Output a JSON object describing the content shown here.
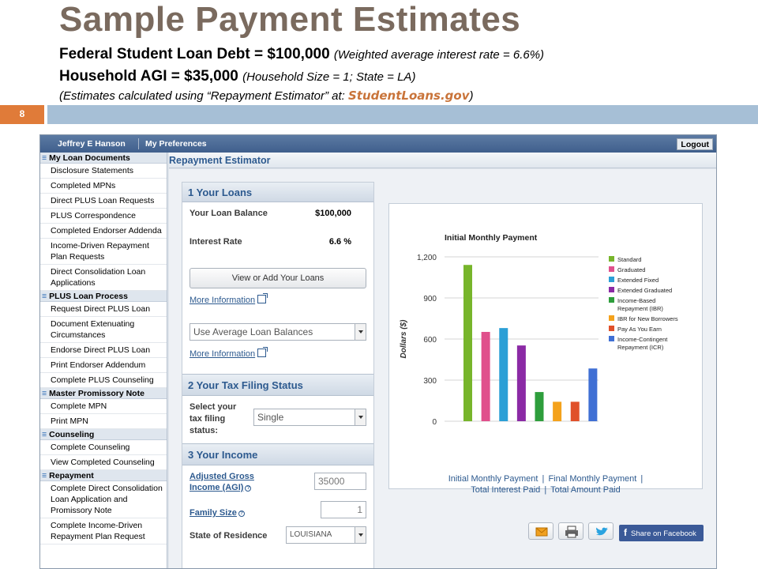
{
  "slide": {
    "title": "Sample Payment Estimates",
    "line1_main": "Federal Student Loan Debt = $100,000",
    "line1_note": "(Weighted average interest rate = 6.6%)",
    "line2_main": "Household AGI = $35,000",
    "line2_note": "(Household Size = 1; State = LA)",
    "line3_prefix": "(Estimates calculated using “Repayment Estimator” at: ",
    "line3_brand": "StudentLoans.gov",
    "line3_suffix": ")",
    "number": "8"
  },
  "topbar": {
    "user": "Jeffrey E Hanson",
    "preferences": "My Preferences",
    "logout": "Logout"
  },
  "sidebar": {
    "sections": [
      {
        "title": "My Loan Documents",
        "items": [
          "Disclosure Statements",
          "Completed MPNs",
          "Direct PLUS Loan Requests",
          "PLUS Correspondence",
          "Completed Endorser Addenda",
          "Income-Driven Repayment Plan Requests",
          "Direct Consolidation Loan Applications"
        ]
      },
      {
        "title": "PLUS Loan Process",
        "items": [
          "Request Direct PLUS Loan",
          "Document Extenuating Circumstances",
          "Endorse Direct PLUS Loan",
          "Print Endorser Addendum",
          "Complete PLUS Counseling"
        ]
      },
      {
        "title": "Master Promissory Note",
        "items": [
          "Complete MPN",
          "Print MPN"
        ]
      },
      {
        "title": "Counseling",
        "items": [
          "Complete Counseling",
          "View Completed Counseling"
        ]
      },
      {
        "title": "Repayment",
        "items": [
          "Complete Direct Consolidation Loan Application and Promissory Note",
          "Complete Income-Driven Repayment Plan Request"
        ]
      }
    ]
  },
  "main": {
    "title": "Repayment Estimator",
    "loans": {
      "heading": "1 Your Loans",
      "balance_label": "Your Loan Balance",
      "balance_value": "$100,000",
      "rate_label": "Interest Rate",
      "rate_value": "6.6 %",
      "view_button": "View or Add Your Loans",
      "more_info_1": "More Information",
      "average_select": "Use Average Loan Balances",
      "more_info_2": "More Information"
    },
    "tax": {
      "heading": "2 Your Tax Filing Status",
      "label": "Select your tax filing status:",
      "value": "Single"
    },
    "income": {
      "heading": "3 Your Income",
      "agi_label": "Adjusted Gross Income (AGI)",
      "agi_value": "35000",
      "family_label": "Family Size",
      "family_value": "1",
      "state_label": "State of Residence",
      "state_value": "LOUISIANA"
    },
    "chart_links": {
      "initial": "Initial Monthly Payment",
      "final": "Final Monthly Payment",
      "total_interest": "Total Interest Paid",
      "total_amount": "Total Amount Paid"
    },
    "share": {
      "facebook": "Share on Facebook"
    }
  },
  "chart_data": {
    "type": "bar",
    "title": "Initial Monthly Payment",
    "ylabel": "Dollars ($)",
    "xlabel": "",
    "ylim": [
      0,
      1200
    ],
    "yticks": [
      0,
      300,
      600,
      900,
      1200
    ],
    "ytick_labels": [
      "0",
      "300",
      "600",
      "900",
      "1,200"
    ],
    "grid": true,
    "legend_position": "right",
    "categories": [
      "Standard",
      "Graduated",
      "Extended Fixed",
      "Extended Graduated",
      "Income-Based Repayment (IBR)",
      "IBR for New Borrowers",
      "Pay As You Earn",
      "Income-Contingent Repayment (ICR)"
    ],
    "values": [
      1141,
      652,
      680,
      553,
      213,
      142,
      142,
      385
    ],
    "colors": [
      "#77b52b",
      "#e0508c",
      "#2b9fd6",
      "#8b2aa5",
      "#2e9e3c",
      "#f4a21c",
      "#e0502a",
      "#3f6fd4"
    ]
  }
}
